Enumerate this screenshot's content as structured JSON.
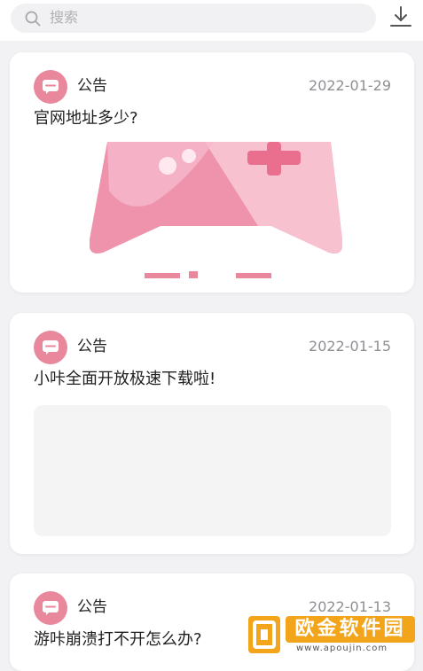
{
  "search": {
    "placeholder": "搜索"
  },
  "posts": [
    {
      "badge": "公告",
      "date": "2022-01-29",
      "title": "官网地址多少?"
    },
    {
      "badge": "公告",
      "date": "2022-01-15",
      "title": "小咔全面开放极速下载啦!"
    },
    {
      "badge": "公告",
      "date": "2022-01-13",
      "title": "游咔崩溃打不开怎么办?"
    }
  ],
  "watermark": {
    "brand": "欧金软件园",
    "url": "www.apoujin.com"
  },
  "colors": {
    "accent": "#e9879c",
    "card": "#ffffff",
    "background": "#f2f2f4"
  }
}
